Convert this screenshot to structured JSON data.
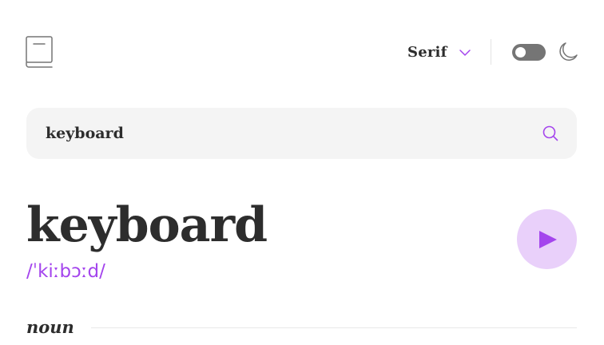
{
  "header": {
    "logo_icon": "book-icon",
    "font_selector": {
      "selected": "Serif",
      "icon": "chevron-down-icon",
      "accent_color": "#a445ed"
    },
    "theme_toggle": {
      "state": "off",
      "icon": "moon-icon"
    }
  },
  "search": {
    "value": "keyboard",
    "icon": "search-icon"
  },
  "entry": {
    "word": "keyboard",
    "phonetic": "/ˈkiːbɔːd/",
    "play_icon": "play-icon",
    "part_of_speech": "noun"
  },
  "colors": {
    "accent": "#a445ed",
    "text": "#2d2d2d",
    "search_bg": "#f4f4f4",
    "play_bg": "#e9d0fa"
  }
}
